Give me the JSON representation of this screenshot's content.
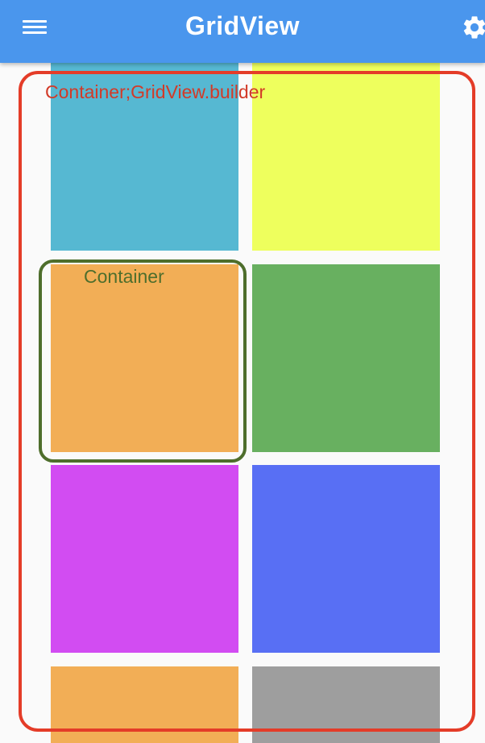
{
  "appbar": {
    "title": "GridView",
    "menu_icon": "hamburger-menu-icon",
    "settings_icon": "gear-icon",
    "color": "#4a96ed"
  },
  "grid": {
    "tiles": [
      {
        "color": "#56b8d2"
      },
      {
        "color": "#eeff5d"
      },
      {
        "color": "#f2ae56"
      },
      {
        "color": "#68b060"
      },
      {
        "color": "#d24cf2"
      },
      {
        "color": "#586ff4"
      },
      {
        "color": "#f2ae56"
      },
      {
        "color": "#9e9e9e"
      }
    ]
  },
  "annotations": {
    "outer_label": "Container;GridView.builder",
    "outer_color": "#e43c28",
    "inner_label": "Container",
    "inner_color": "#4e6e2c"
  }
}
